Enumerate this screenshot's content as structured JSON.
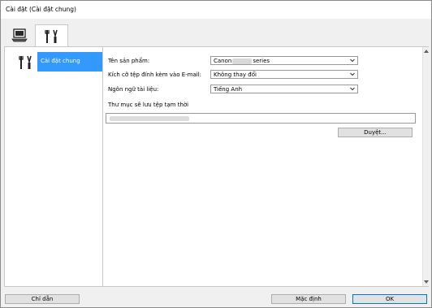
{
  "window": {
    "title": "Cài đặt (Cài đặt chung)"
  },
  "tabs": [
    {
      "icon": "computer-icon"
    },
    {
      "icon": "tools-icon"
    }
  ],
  "sidebar": {
    "items": [
      {
        "label": "Cài đặt chung",
        "icon": "tools-icon",
        "selected": true
      }
    ]
  },
  "form": {
    "product_name_label": "Tên sản phẩm:",
    "product_name_value_prefix": "Canon",
    "product_name_value_suffix": "series",
    "attachment_size_label": "Kích cỡ tệp đính kèm vào E-mail:",
    "attachment_size_value": "Không thay đổi",
    "doc_language_label": "Ngôn ngữ tài liệu:",
    "doc_language_value": "Tiếng Anh",
    "temp_folder_label": "Thư mục sẽ lưu tệp tạm thời",
    "browse_button": "Duyệt..."
  },
  "footer": {
    "help_button": "Chỉ dẫn",
    "defaults_button": "Mặc định",
    "ok_button": "OK"
  },
  "colors": {
    "selection": "#3399ff",
    "window_bg": "#f0f0f0"
  }
}
